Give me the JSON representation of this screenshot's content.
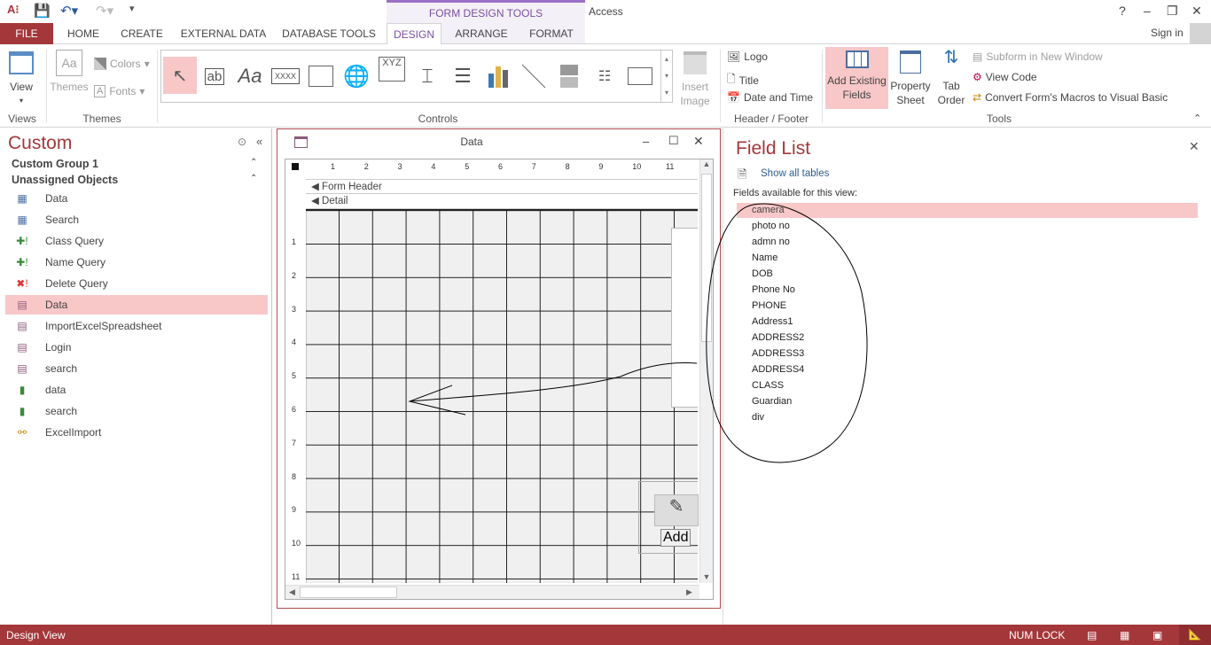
{
  "app": {
    "title": "Access",
    "context_tab_group": "FORM DESIGN TOOLS",
    "sign_in": "Sign in",
    "help": "?"
  },
  "tabs": [
    {
      "label": "FILE"
    },
    {
      "label": "HOME"
    },
    {
      "label": "CREATE"
    },
    {
      "label": "EXTERNAL DATA"
    },
    {
      "label": "DATABASE TOOLS"
    },
    {
      "label": "DESIGN",
      "active": true
    },
    {
      "label": "ARRANGE"
    },
    {
      "label": "FORMAT"
    }
  ],
  "ribbon": {
    "views": {
      "view": "View",
      "label": "Views"
    },
    "themes": {
      "themes": "Themes",
      "colors": "Colors",
      "fonts": "Fonts",
      "label": "Themes"
    },
    "controls": {
      "label": "Controls",
      "textbox": "ab",
      "label_ctl": "Aa",
      "button": "XXXX",
      "xyz": "XYZ",
      "insert_image": "Insert Image"
    },
    "header_footer": {
      "logo": "Logo",
      "title": "Title",
      "date_time": "Date and Time",
      "label": "Header / Footer"
    },
    "tools": {
      "add_existing": "Add Existing Fields",
      "property_sheet": "Property Sheet",
      "tab_order": "Tab Order",
      "subform": "Subform in New Window",
      "view_code": "View Code",
      "convert": "Convert Form's Macros to Visual Basic",
      "label": "Tools"
    }
  },
  "nav": {
    "title": "Custom",
    "groups": [
      "Custom Group 1",
      "Unassigned Objects"
    ],
    "items": [
      {
        "label": "Data",
        "type": "table"
      },
      {
        "label": "Search",
        "type": "table"
      },
      {
        "label": "Class Query",
        "type": "append-query"
      },
      {
        "label": "Name Query",
        "type": "append-query"
      },
      {
        "label": "Delete Query",
        "type": "delete-query"
      },
      {
        "label": "Data",
        "type": "form",
        "selected": true
      },
      {
        "label": "ImportExcelSpreadsheet",
        "type": "form"
      },
      {
        "label": "Login",
        "type": "form"
      },
      {
        "label": "search",
        "type": "form"
      },
      {
        "label": "data",
        "type": "macro"
      },
      {
        "label": "search",
        "type": "macro"
      },
      {
        "label": "ExcelImport",
        "type": "saved-import"
      }
    ]
  },
  "form": {
    "title": "Data",
    "sections": {
      "header": "Form Header",
      "detail": "Detail"
    },
    "add_button": "Add",
    "hruler": [
      "1",
      "2",
      "3",
      "4",
      "5",
      "6",
      "7",
      "8",
      "9",
      "10",
      "11"
    ],
    "vruler": [
      "1",
      "2",
      "3",
      "4",
      "5",
      "6",
      "7",
      "8",
      "9",
      "10",
      "11"
    ]
  },
  "field_list": {
    "title": "Field List",
    "show_all": "Show all tables",
    "available": "Fields available for this view:",
    "fields": [
      "camera",
      "photo no",
      "admn no",
      "Name",
      "DOB",
      "Phone No",
      "PHONE",
      "Address1",
      "ADDRESS2",
      "ADDRESS3",
      "ADDRESS4",
      "CLASS",
      "Guardian",
      "div"
    ],
    "selected": "camera"
  },
  "status": {
    "mode": "Design View",
    "numlock": "NUM LOCK"
  },
  "colors": {
    "accent": "#a4373a",
    "context": "#7b4fa3",
    "selection": "#f8c7c8"
  }
}
